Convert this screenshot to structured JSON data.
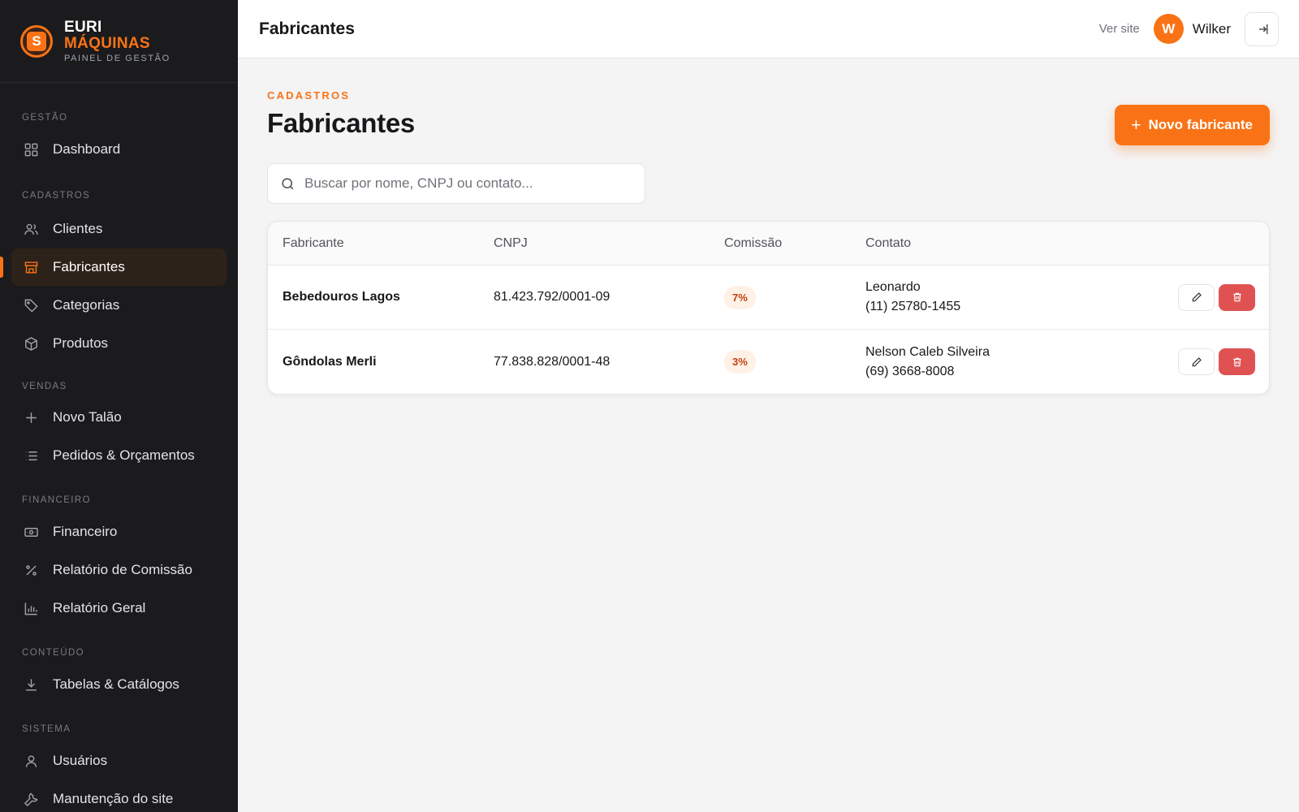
{
  "brand": {
    "line1": "EURI",
    "line2": "MÁQUINAS",
    "line3": "PAINEL DE GESTÃO",
    "logo_letter": "S"
  },
  "sidebar": {
    "sections": {
      "gestao": "GESTÃO",
      "cadastros": "CADASTROS",
      "vendas": "VENDAS",
      "financeiro": "FINANCEIRO",
      "conteudo": "CONTEÚDO",
      "sistema": "SISTEMA"
    },
    "items": {
      "dashboard": "Dashboard",
      "clientes": "Clientes",
      "fabricantes": "Fabricantes",
      "categorias": "Categorias",
      "produtos": "Produtos",
      "novo_talao": "Novo Talão",
      "pedidos": "Pedidos & Orçamentos",
      "financeiro": "Financeiro",
      "relatorio_comissao": "Relatório de Comissão",
      "relatorio_geral": "Relatório Geral",
      "tabelas": "Tabelas & Catálogos",
      "usuarios": "Usuários",
      "manutencao": "Manutenção do site"
    },
    "active": "fabricantes"
  },
  "header": {
    "title": "Fabricantes",
    "ver_site": "Ver site",
    "avatar_initial": "W",
    "user_name": "Wilker"
  },
  "page": {
    "eyebrow": "CADASTROS",
    "title": "Fabricantes",
    "new_button": "Novo fabricante",
    "new_button_icon": "+"
  },
  "search": {
    "placeholder": "Buscar por nome, CNPJ ou contato...",
    "value": ""
  },
  "table": {
    "columns": {
      "fabricante": "Fabricante",
      "cnpj": "CNPJ",
      "comissao": "Comissão",
      "contato": "Contato"
    },
    "rows": [
      {
        "name": "Bebedouros Lagos",
        "cnpj": "81.423.792/0001-09",
        "commission": "7%",
        "contact_name": "Leonardo",
        "contact_phone": "(11) 25780-1455"
      },
      {
        "name": "Gôndolas Merli",
        "cnpj": "77.838.828/0001-48",
        "commission": "3%",
        "contact_name": "Nelson Caleb Silveira",
        "contact_phone": "(69) 3668-8008"
      }
    ]
  },
  "colors": {
    "accent": "#f97316",
    "sidebar_bg": "#1b1b1d",
    "danger": "#e05252",
    "page_bg": "#f4f4f5"
  },
  "icons": {
    "dashboard": "grid-icon",
    "clientes": "users-icon",
    "fabricantes": "store-icon",
    "categorias": "tag-icon",
    "produtos": "box-icon",
    "novo_talao": "plus-icon",
    "pedidos": "list-icon",
    "financeiro": "banknote-icon",
    "relatorio_comissao": "percent-icon",
    "relatorio_geral": "bar-chart-icon",
    "tabelas": "download-icon",
    "usuarios": "user-icon",
    "manutencao": "wrench-icon",
    "search": "search-icon",
    "edit": "pencil-icon",
    "delete": "trash-icon",
    "logout": "logout-icon"
  }
}
